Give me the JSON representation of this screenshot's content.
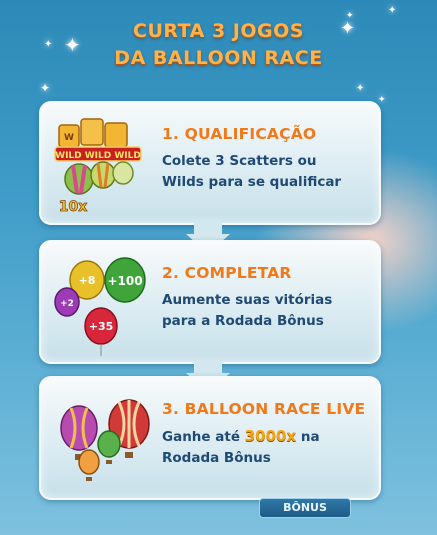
{
  "title": {
    "line1": "CURTA 3 JOGOS",
    "line2": "DA BALLOON RACE"
  },
  "steps": [
    {
      "heading": "1. QUALIFICAÇÃO",
      "desc_line1": "Colete 3 Scatters ou",
      "desc_line2": "Wilds para se qualificar",
      "icon_labels": [
        "WILD",
        "WILD",
        "WILD",
        "10x"
      ]
    },
    {
      "heading": "2. COMPLETAR",
      "desc_line1": "Aumente suas vitórias",
      "desc_line2": "para a Rodada Bônus",
      "icon_labels": [
        "+8",
        "+100",
        "+2",
        "+35"
      ]
    },
    {
      "heading": "3. BALLOON RACE LIVE",
      "desc_prefix": "Ganhe até",
      "desc_highlight": "3000x",
      "desc_suffix": "na",
      "desc_line2": "Rodada Bônus"
    }
  ],
  "bonus_button": "BÔNUS",
  "colors": {
    "heading": "#f07a1a",
    "body_text": "#1f4a74",
    "title": "#ffb14a",
    "background_top": "#2d8ab8"
  }
}
